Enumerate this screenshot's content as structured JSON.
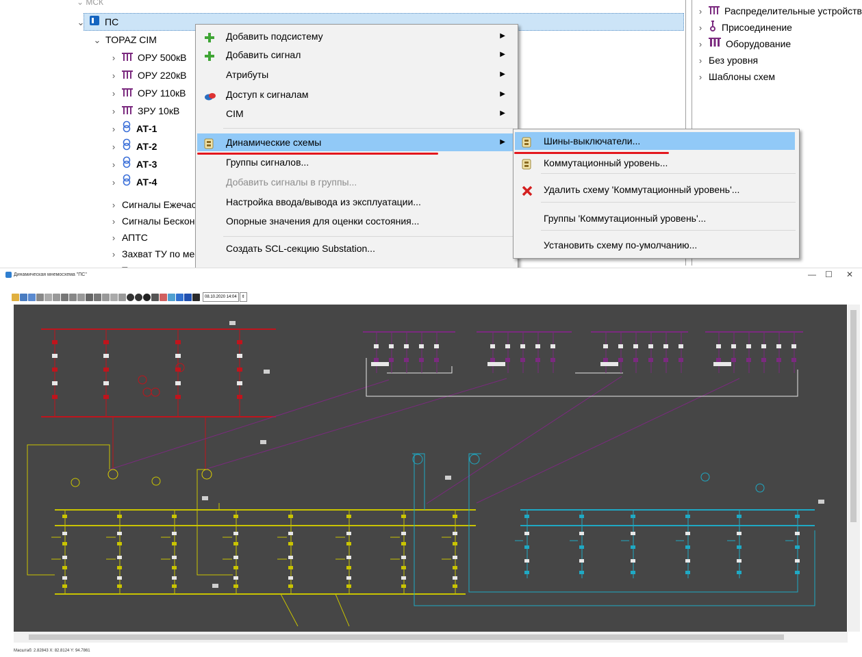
{
  "tree": {
    "rows": [
      {
        "label": "ПС",
        "kind": "root",
        "bold": false
      },
      {
        "label": "TOPAZ CIM",
        "kind": "folder",
        "bold": false
      },
      {
        "label": "ОРУ 500кВ",
        "kind": "bus",
        "bold": false
      },
      {
        "label": "ОРУ 220кВ",
        "kind": "bus",
        "bold": false
      },
      {
        "label": "ОРУ 110кВ",
        "kind": "bus",
        "bold": false
      },
      {
        "label": "ЗРУ 10кВ",
        "kind": "bus",
        "bold": false
      },
      {
        "label": "АТ-1",
        "kind": "transformer",
        "bold": true
      },
      {
        "label": "АТ-2",
        "kind": "transformer",
        "bold": true
      },
      {
        "label": "АТ-3",
        "kind": "transformer",
        "bold": true
      },
      {
        "label": "АТ-4",
        "kind": "transformer",
        "bold": true
      },
      {
        "label": "Сигналы Ежечасные",
        "kind": "plain",
        "bold": false
      },
      {
        "label": "Сигналы Бесконечные",
        "kind": "plain",
        "bold": false
      },
      {
        "label": "АПТС",
        "kind": "plain",
        "bold": false
      },
      {
        "label": "Захват ТУ по месту",
        "kind": "plain",
        "bold": false
      },
      {
        "label": "Температура",
        "kind": "plain",
        "bold": false
      }
    ]
  },
  "right_panel": {
    "items": [
      {
        "label": "Распределительные устройства",
        "icon": "bus-icon"
      },
      {
        "label": "Присоединение",
        "icon": "connection-icon"
      },
      {
        "label": "Оборудование",
        "icon": "equipment-icon"
      },
      {
        "label": "Без уровня",
        "icon": ""
      },
      {
        "label": "Шаблоны схем",
        "icon": ""
      }
    ]
  },
  "context_menu": {
    "items": [
      {
        "label": "Добавить подсистему",
        "icon": "plus-icon",
        "submenu": true,
        "disabled": false
      },
      {
        "label": "Добавить сигнал",
        "icon": "plus-icon",
        "submenu": true,
        "disabled": false
      },
      {
        "label": "Атрибуты",
        "icon": "",
        "submenu": true,
        "disabled": false
      },
      {
        "label": "Доступ к сигналам",
        "icon": "access-icon",
        "submenu": true,
        "disabled": false
      },
      {
        "label": "CIM",
        "icon": "",
        "submenu": true,
        "disabled": false
      },
      {
        "label": "Динамические схемы",
        "icon": "scheme-icon",
        "submenu": true,
        "disabled": false,
        "highlighted": true
      },
      {
        "label": "Группы сигналов...",
        "icon": "",
        "submenu": false,
        "disabled": false
      },
      {
        "label": "Добавить сигналы в группы...",
        "icon": "",
        "submenu": false,
        "disabled": true
      },
      {
        "label": "Настройка ввода/вывода из эксплуатации...",
        "icon": "",
        "submenu": false,
        "disabled": false
      },
      {
        "label": "Опорные значения для оценки состояния...",
        "icon": "",
        "submenu": false,
        "disabled": false
      },
      {
        "label": "Создать SCL-секцию Substation...",
        "icon": "",
        "submenu": false,
        "disabled": false
      }
    ]
  },
  "submenu": {
    "items": [
      {
        "label": "Шины-выключатели...",
        "icon": "scheme-icon",
        "highlighted": true
      },
      {
        "label": "Коммутационный уровень...",
        "icon": "scheme-icon"
      },
      {
        "label": "Удалить схему 'Коммутационный уровень'...",
        "icon": "delete-icon"
      },
      {
        "label": "Группы 'Коммутационный уровень'...",
        "icon": ""
      },
      {
        "label": "Установить схему по-умолчанию...",
        "icon": ""
      }
    ]
  },
  "diagram_window": {
    "title": "Динамическая мнемосхема \"ПС\"",
    "datetime": "08.10.2020 14:04",
    "status": "Масштаб: 2.82843  X: 82.8124 Y: 94.7861",
    "colors": {
      "bg": "#464646",
      "red": "#c0141c",
      "purple": "#7b2a7f",
      "yellow": "#c9c400",
      "cyan": "#1fa9c4",
      "white": "#e8e8e8"
    }
  }
}
